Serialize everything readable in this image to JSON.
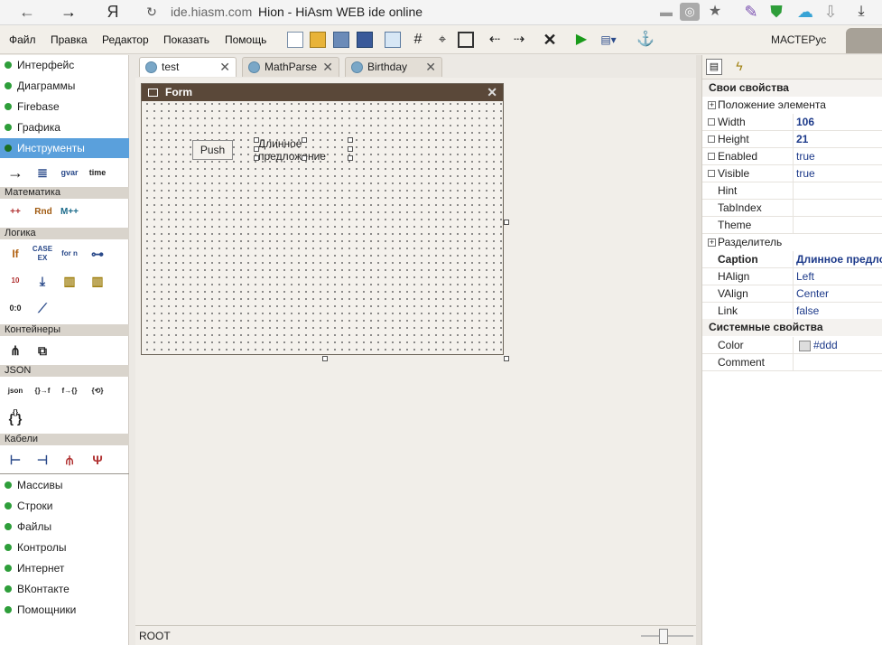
{
  "browser": {
    "host": "ide.hiasm.com",
    "title": "Hion - HiAsm WEB ide online",
    "icons": [
      "back-arrow-icon",
      "forward-arrow-icon",
      "yandex-icon",
      "reload-icon",
      "comment-icon",
      "vpn-icon",
      "star-icon",
      "feather-icon",
      "shield-icon",
      "ghost-icon",
      "download-arrow-icon",
      "download-icon"
    ]
  },
  "menu": [
    "Файл",
    "Правка",
    "Редактор",
    "Показать",
    "Помощь"
  ],
  "toolbar": {
    "master_label": "МАСТЕРус"
  },
  "palette": {
    "top_items": [
      "Интерфейс",
      "Диаграммы",
      "Firebase",
      "Графика",
      "Инструменты"
    ],
    "selected": "Инструменты",
    "sections": [
      {
        "title": "Математика",
        "icons": [
          "++",
          "Rnd",
          "M++"
        ]
      },
      {
        "title": "Логика",
        "icons": [
          "If",
          "CASE EX",
          "for n",
          "link"
        ]
      },
      {
        "title": "Контейнеры",
        "icons": [
          "tree",
          "tree2"
        ]
      },
      {
        "title": "JSON",
        "icons": [
          "json {}",
          "{}→f",
          "f→{}",
          "{⟲}",
          "{ }"
        ]
      },
      {
        "title": "Кабели",
        "icons": [
          "cable1",
          "cable2",
          "cable3",
          "cable4"
        ]
      }
    ],
    "tool_icons": [
      "→",
      "stack",
      "gvar",
      "time"
    ],
    "bottom_items": [
      "Массивы",
      "Строки",
      "Файлы",
      "Контролы",
      "Интернет",
      "ВКонтакте",
      "Помощники"
    ]
  },
  "tabs": [
    {
      "label": "test",
      "active": true
    },
    {
      "label": "MathParse",
      "active": false
    },
    {
      "label": "Birthday",
      "active": false
    }
  ],
  "form": {
    "title": "Form",
    "button_label": "Push",
    "label_text": "Длинное предложение"
  },
  "status": {
    "root": "ROOT"
  },
  "properties": {
    "own_title": "Свои свойства",
    "position_group": "Положение элемента",
    "rows_a": [
      {
        "name": "Width",
        "value": "106",
        "bold": true,
        "check": true
      },
      {
        "name": "Height",
        "value": "21",
        "bold": true,
        "check": true
      },
      {
        "name": "Enabled",
        "value": "true",
        "bold": false,
        "check": true
      },
      {
        "name": "Visible",
        "value": "true",
        "bold": false,
        "check": true
      },
      {
        "name": "Hint",
        "value": "",
        "bold": false,
        "check": false
      },
      {
        "name": "TabIndex",
        "value": "",
        "bold": false,
        "check": false
      },
      {
        "name": "Theme",
        "value": "",
        "bold": false,
        "check": false
      }
    ],
    "separator_group": "Разделитель",
    "rows_b": [
      {
        "name": "Caption",
        "value": "Длинное предложение",
        "bold": true,
        "namebold": true
      },
      {
        "name": "HAlign",
        "value": "Left",
        "bold": false
      },
      {
        "name": "VAlign",
        "value": "Center",
        "bold": false
      },
      {
        "name": "Link",
        "value": "false",
        "bold": false
      }
    ],
    "system_title": "Системные свойства",
    "rows_c": [
      {
        "name": "Color",
        "value": "#ddd"
      },
      {
        "name": "Comment",
        "value": ""
      }
    ]
  }
}
